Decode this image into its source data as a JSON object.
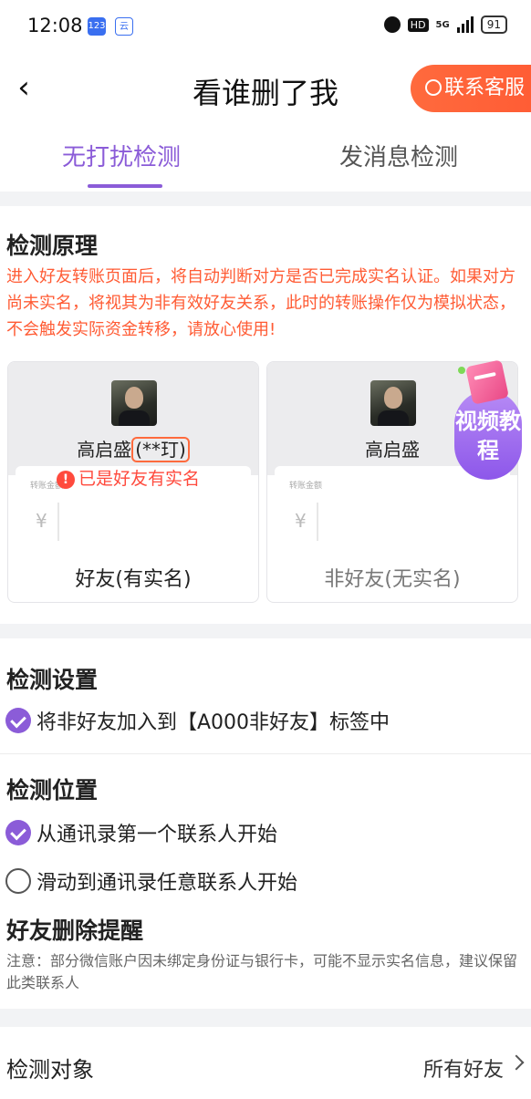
{
  "status_bar": {
    "time": "12:08",
    "badge1": "123",
    "badge2": "云",
    "hd": "HD",
    "network": "5G",
    "battery": "91"
  },
  "header": {
    "title": "看谁删了我",
    "contact_service": "联系客服"
  },
  "tabs": [
    {
      "label": "无打扰检测",
      "active": true
    },
    {
      "label": "发消息检测",
      "active": false
    }
  ],
  "principle": {
    "title": "检测原理",
    "notice": "进入好友转账页面后，将自动判断对方是否已完成实名认证。如果对方尚未实名，将视其为非有效好友关系，此时的转账操作仅为模拟状态，不会触发实际资金转移，请放心使用!",
    "cards": [
      {
        "name": "高启盛",
        "masked": "(**玎)",
        "amount_label": "转账金额",
        "currency": "¥",
        "caption": "好友(有实名)"
      },
      {
        "name": "高启盛",
        "amount_label": "转账金额",
        "currency": "¥",
        "caption": "非好友(无实名)"
      }
    ],
    "warning": "已是好友有实名",
    "video_badge": "视频教程"
  },
  "settings": {
    "title": "检测设置",
    "option": "将非好友加入到【A000非好友】标签中"
  },
  "position": {
    "title": "检测位置",
    "options": [
      {
        "label": "从通讯录第一个联系人开始",
        "checked": true
      },
      {
        "label": "滑动到通讯录任意联系人开始",
        "checked": false
      }
    ]
  },
  "reminder": {
    "title": "好友删除提醒",
    "note": "注意：部分微信账户因未绑定身份证与银行卡，可能不显示实名信息，建议保留此类联系人"
  },
  "target": {
    "label": "检测对象",
    "value": "所有好友"
  },
  "colors": {
    "accent": "#8b5cd8",
    "warning": "#ff5b34"
  }
}
